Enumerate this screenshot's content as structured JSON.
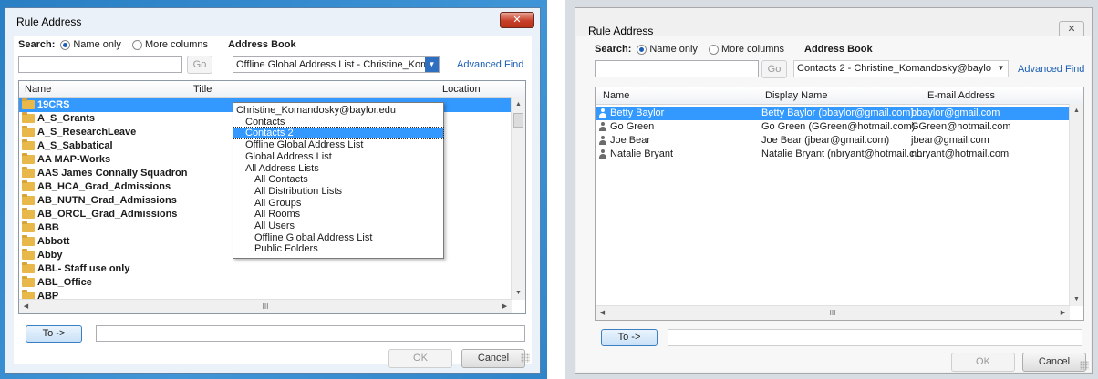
{
  "left": {
    "title": "Rule Address",
    "close_glyph": "✕",
    "search_label": "Search:",
    "name_only_label": "Name only",
    "more_columns_label": "More columns",
    "address_book_label": "Address Book",
    "go_label": "Go",
    "address_book_value": "Offline Global Address List - Christine_Komandosky@baylor.edu",
    "advanced_find_label": "Advanced Find",
    "columns": [
      "Name",
      "Title",
      "Location"
    ],
    "rows": [
      "19CRS",
      "A_S_Grants",
      "A_S_ResearchLeave",
      "A_S_Sabbatical",
      "AA MAP-Works",
      "AAS James Connally Squadron",
      "AB_HCA_Grad_Admissions",
      "AB_NUTN_Grad_Admissions",
      "AB_ORCL_Grad_Admissions",
      "ABB",
      "Abbott",
      "Abby",
      "ABL- Staff use only",
      "ABL_Office",
      "ABP"
    ],
    "selected_row": 0,
    "dropdown_items": [
      {
        "label": "Christine_Komandosky@baylor.edu",
        "indent": 0
      },
      {
        "label": "Contacts",
        "indent": 1
      },
      {
        "label": "Contacts 2",
        "indent": 1
      },
      {
        "label": "Offline Global Address List",
        "indent": 1
      },
      {
        "label": "Global Address List",
        "indent": 1
      },
      {
        "label": "All Address Lists",
        "indent": 1
      },
      {
        "label": "All Contacts",
        "indent": 2
      },
      {
        "label": "All Distribution Lists",
        "indent": 2
      },
      {
        "label": "All Groups",
        "indent": 2
      },
      {
        "label": "All Rooms",
        "indent": 2
      },
      {
        "label": "All Users",
        "indent": 2
      },
      {
        "label": "Offline Global Address List",
        "indent": 2
      },
      {
        "label": "Public Folders",
        "indent": 2
      }
    ],
    "dropdown_selected": 2,
    "to_label": "To ->",
    "ok_label": "OK",
    "cancel_label": "Cancel",
    "scroll_grip": "III"
  },
  "right": {
    "title": "Rule Address",
    "close_glyph": "✕",
    "search_label": "Search:",
    "name_only_label": "Name only",
    "more_columns_label": "More columns",
    "address_book_label": "Address Book",
    "go_label": "Go",
    "address_book_value": "Contacts 2 - Christine_Komandosky@baylo",
    "advanced_find_label": "Advanced Find",
    "columns": [
      "Name",
      "Display Name",
      "E-mail Address"
    ],
    "rows": [
      {
        "name": "Betty Baylor",
        "display": "Betty Baylor (bbaylor@gmail.com)",
        "email": "bbaylor@gmail.com"
      },
      {
        "name": "Go Green",
        "display": "Go Green (GGreen@hotmail.com)",
        "email": "GGreen@hotmail.com"
      },
      {
        "name": "Joe Bear",
        "display": "Joe Bear (jbear@gmail.com)",
        "email": "jbear@gmail.com"
      },
      {
        "name": "Natalie Bryant",
        "display": "Natalie Bryant (nbryant@hotmail.c...",
        "email": "nbryant@hotmail.com"
      }
    ],
    "selected_row": 0,
    "to_label": "To ->",
    "ok_label": "OK",
    "cancel_label": "Cancel",
    "scroll_grip": "III"
  },
  "colors": {
    "selection": "#3399ff",
    "link": "#1a5fb4",
    "folder": "#e9b84a",
    "desktop_bg": "#2f85c9"
  },
  "icons": {
    "row_left": "folder-group-icon",
    "row_right": "contact-person-icon"
  }
}
